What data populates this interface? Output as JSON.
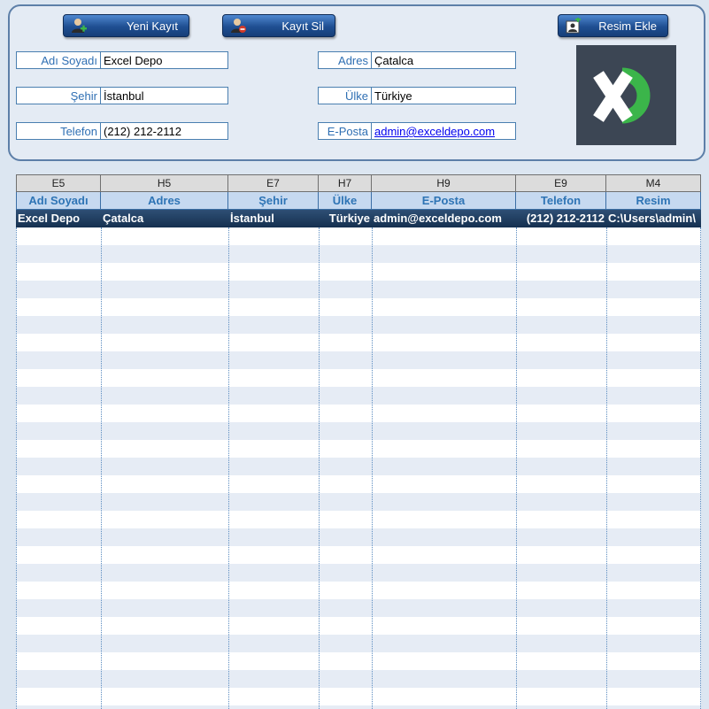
{
  "toolbar": {
    "new_record_label": "Yeni Kayıt",
    "delete_record_label": "Kayıt Sil",
    "add_image_label": "Resim Ekle"
  },
  "form": {
    "name_label": "Adı Soyadı",
    "name_value": "Excel Depo",
    "address_label": "Adres",
    "address_value": "Çatalca",
    "city_label": "Şehir",
    "city_value": "İstanbul",
    "country_label": "Ülke",
    "country_value": "Türkiye",
    "phone_label": "Telefon",
    "phone_value": "(212) 212-2112",
    "email_label": "E-Posta",
    "email_value": "admin@exceldepo.com"
  },
  "logo": {
    "bg_color": "#3c4654",
    "accent_color": "#3bb54a"
  },
  "table": {
    "refs": [
      "E5",
      "H5",
      "E7",
      "H7",
      "H9",
      "E9",
      "M4"
    ],
    "headers": [
      "Adı Soyadı",
      "Adres",
      "Şehir",
      "Ülke",
      "E-Posta",
      "Telefon",
      "Resim"
    ],
    "rows": [
      [
        "Excel Depo",
        "Çatalca",
        "İstanbul",
        "Türkiye",
        "admin@exceldepo.com",
        "(212) 212-2112",
        "C:\\Users\\admin\\"
      ]
    ]
  }
}
